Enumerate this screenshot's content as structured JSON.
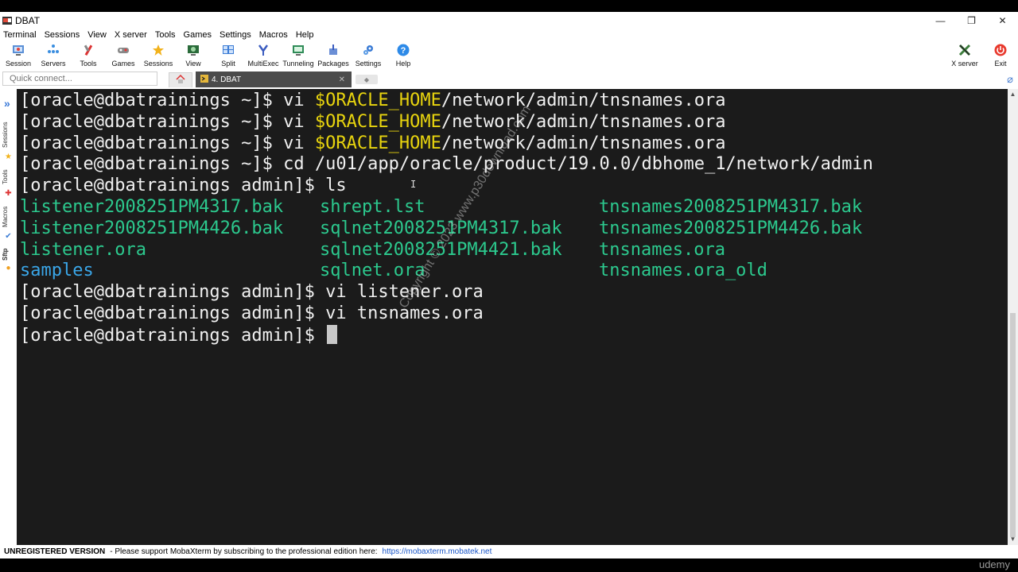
{
  "window": {
    "title": "DBAT",
    "minimize": "—",
    "maximize": "❐",
    "close": "✕"
  },
  "menu": [
    "Terminal",
    "Sessions",
    "View",
    "X server",
    "Tools",
    "Games",
    "Settings",
    "Macros",
    "Help"
  ],
  "toolbar": {
    "buttons": [
      {
        "label": "Session",
        "icon": "session-icon"
      },
      {
        "label": "Servers",
        "icon": "servers-icon"
      },
      {
        "label": "Tools",
        "icon": "tools-icon"
      },
      {
        "label": "Games",
        "icon": "games-icon"
      },
      {
        "label": "Sessions",
        "icon": "sessions-star-icon"
      },
      {
        "label": "View",
        "icon": "view-icon"
      },
      {
        "label": "Split",
        "icon": "split-icon"
      },
      {
        "label": "MultiExec",
        "icon": "multiexec-icon"
      },
      {
        "label": "Tunneling",
        "icon": "tunneling-icon"
      },
      {
        "label": "Packages",
        "icon": "packages-icon"
      },
      {
        "label": "Settings",
        "icon": "settings-icon"
      },
      {
        "label": "Help",
        "icon": "help-icon"
      }
    ],
    "xserver_label": "X server",
    "exit_label": "Exit"
  },
  "tabs": {
    "quick_connect_placeholder": "Quick connect...",
    "active_tab_label": "4. DBAT",
    "active_tab_close": "✕"
  },
  "sidebar": {
    "labels": [
      "Sessions",
      "Tools",
      "Macros",
      "Sftp"
    ]
  },
  "terminal": {
    "prompt_home": "[oracle@dbatrainings ~]$ ",
    "prompt_admin": "[oracle@dbatrainings admin]$ ",
    "cmd_vi": "vi ",
    "env_var": "$ORACLE_HOME",
    "tns_path": "/network/admin/tnsnames.ora",
    "cmd_cd": "cd /u01/app/oracle/product/19.0.0/dbhome_1/network/admin",
    "cmd_ls": "ls",
    "ls_rows": [
      [
        "listener2008251PM4317.bak",
        "shrept.lst",
        "tnsnames2008251PM4317.bak"
      ],
      [
        "listener2008251PM4426.bak",
        "sqlnet2008251PM4317.bak",
        "tnsnames2008251PM4426.bak"
      ],
      [
        "listener.ora",
        "sqlnet2008251PM4421.bak",
        "tnsnames.ora"
      ],
      [
        "samples",
        "sqlnet.ora",
        "tnsnames.ora_old"
      ]
    ],
    "cmd_vi_listener": "vi listener.ora",
    "cmd_vi_tnsnames": "vi tnsnames.ora",
    "watermark": "Copyright © 2023 www.p30download.com"
  },
  "status": {
    "unregistered": "UNREGISTERED VERSION",
    "message": "-  Please support MobaXterm by subscribing to the professional edition here:",
    "link": "https://mobaxterm.mobatek.net"
  },
  "overlay": {
    "udemy": "udemy"
  },
  "colors": {
    "terminal_bg": "#1b1b1b",
    "prompt_text": "#f0f0f0",
    "env_var": "#e8d40e",
    "file_green": "#2cc98e",
    "dir_blue": "#3aa6e8",
    "active_tab_bg": "#4b4b4b",
    "link": "#1a56c8"
  }
}
